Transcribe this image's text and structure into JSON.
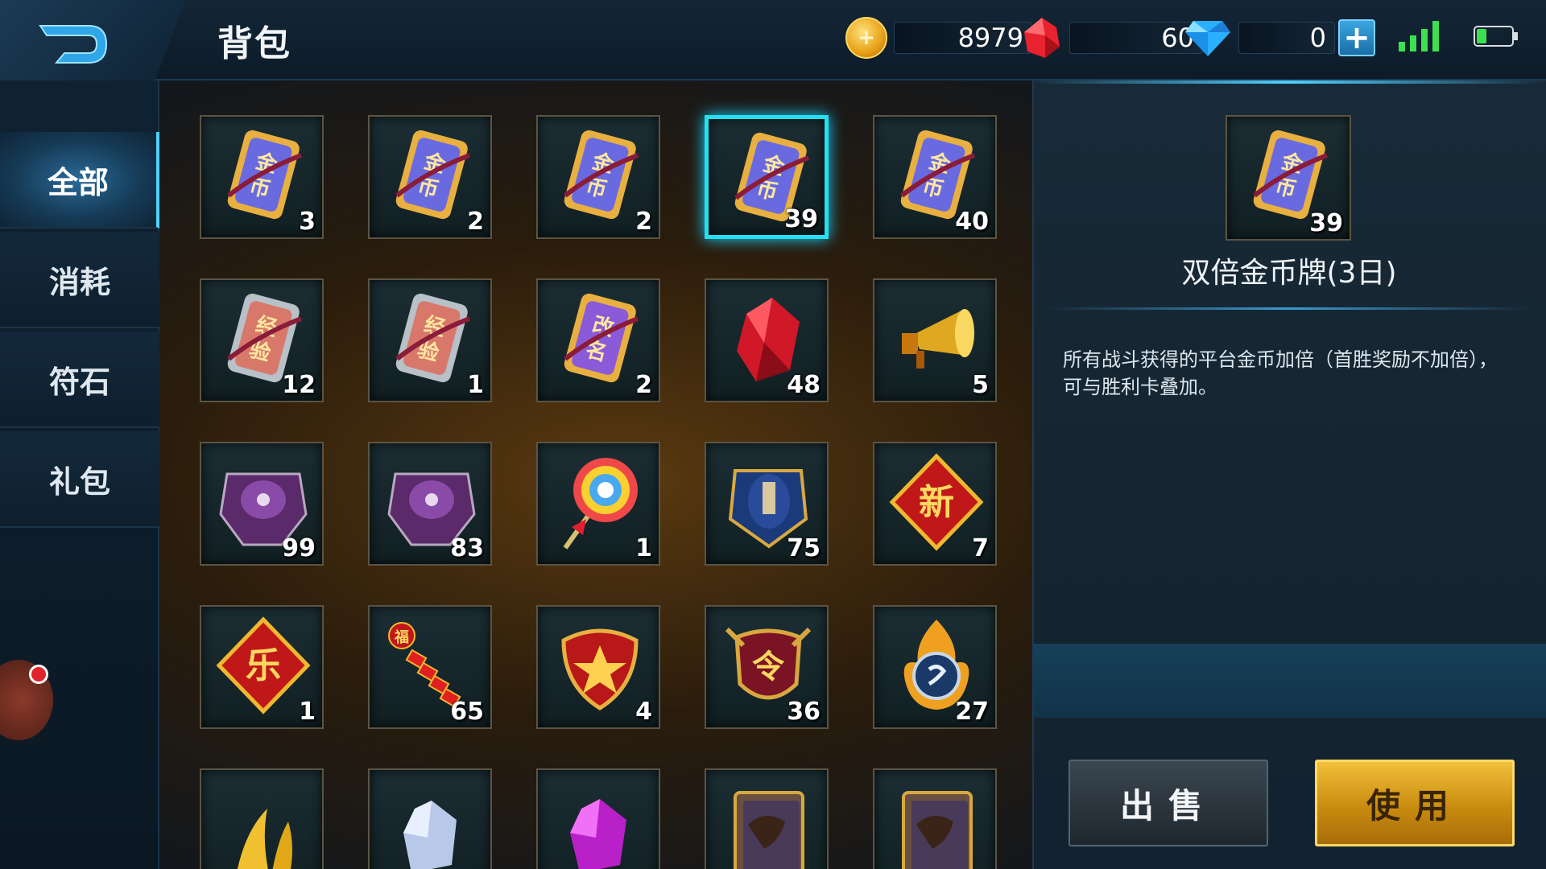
{
  "header": {
    "title": "背包"
  },
  "currencies": {
    "gold": {
      "value": "8979",
      "icon": "gold-coin-icon"
    },
    "ruby": {
      "value": "60",
      "icon": "ruby-crystal-icon"
    },
    "diamond": {
      "value": "0",
      "icon": "diamond-icon",
      "add_label": "+"
    }
  },
  "sidebar": {
    "items": [
      {
        "label": "全部",
        "active": true
      },
      {
        "label": "消耗",
        "active": false
      },
      {
        "label": "符石",
        "active": false
      },
      {
        "label": "礼包",
        "active": false
      }
    ]
  },
  "inventory": [
    {
      "icon": "gold-card-icon",
      "label": "金币",
      "qty": "3"
    },
    {
      "icon": "gold-card-icon",
      "label": "金币",
      "qty": "2"
    },
    {
      "icon": "gold-card-icon",
      "label": "金币",
      "qty": "2"
    },
    {
      "icon": "gold-card-icon",
      "label": "金币",
      "qty": "39",
      "selected": true
    },
    {
      "icon": "gold-card-icon",
      "label": "金币",
      "qty": "40"
    },
    {
      "icon": "exp-card-icon",
      "label": "经验",
      "qty": "12"
    },
    {
      "icon": "exp-card-icon",
      "label": "经验",
      "qty": "1"
    },
    {
      "icon": "rename-card-icon",
      "label": "改名",
      "qty": "2"
    },
    {
      "icon": "red-crystal-icon",
      "qty": "48"
    },
    {
      "icon": "megaphone-icon",
      "qty": "5"
    },
    {
      "icon": "purple-armor-icon",
      "qty": "99"
    },
    {
      "icon": "purple-armor-icon",
      "qty": "83"
    },
    {
      "icon": "lollipop-icon",
      "qty": "1"
    },
    {
      "icon": "blue-helmet-icon",
      "qty": "75"
    },
    {
      "icon": "xin-diamond-icon",
      "label": "新",
      "qty": "7"
    },
    {
      "icon": "le-diamond-icon",
      "label": "乐",
      "qty": "1"
    },
    {
      "icon": "firecracker-icon",
      "label": "福",
      "qty": "65"
    },
    {
      "icon": "star-shield-icon",
      "qty": "4"
    },
    {
      "icon": "ling-badge-icon",
      "label": "令",
      "qty": "36"
    },
    {
      "icon": "flame-emblem-icon",
      "qty": "27"
    },
    {
      "icon": "banana-icon",
      "qty": ""
    },
    {
      "icon": "white-crystal-icon",
      "qty": ""
    },
    {
      "icon": "purple-crystal-icon",
      "qty": ""
    },
    {
      "icon": "hero-card-icon",
      "qty": ""
    },
    {
      "icon": "hero-card-icon",
      "qty": ""
    }
  ],
  "detail": {
    "icon": "gold-card-icon",
    "card_label": "金币",
    "qty": "39",
    "name": "双倍金币牌(3日)",
    "description": "所有战斗获得的平台金币加倍（首胜奖励不加倍），可与胜利卡叠加。",
    "sell_label": "出售",
    "use_label": "使用"
  },
  "colors": {
    "selected_border": "#24e0f0",
    "use_button": "#e0a820",
    "accent": "#4fd0ff"
  }
}
